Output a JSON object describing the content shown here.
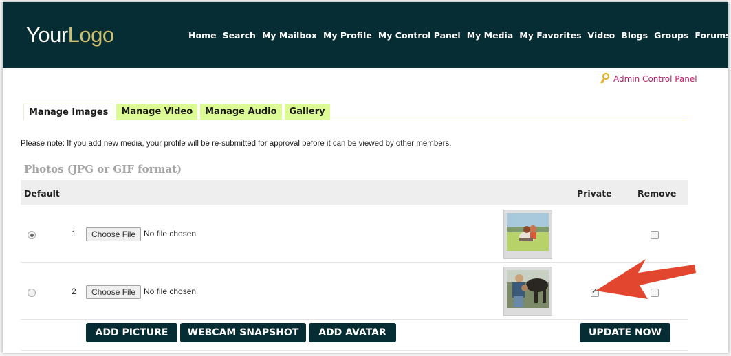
{
  "logo": {
    "your": "Your",
    "logo": "Logo"
  },
  "nav": [
    {
      "label": "Home",
      "name": "nav-home"
    },
    {
      "label": "Search",
      "name": "nav-search"
    },
    {
      "label": "My Mailbox",
      "name": "nav-my-mailbox"
    },
    {
      "label": "My Profile",
      "name": "nav-my-profile"
    },
    {
      "label": "My Control Panel",
      "name": "nav-my-control-panel"
    },
    {
      "label": "My Media",
      "name": "nav-my-media"
    },
    {
      "label": "My Favorites",
      "name": "nav-my-favorites"
    },
    {
      "label": "Video",
      "name": "nav-video"
    },
    {
      "label": "Blogs",
      "name": "nav-blogs"
    },
    {
      "label": "Groups",
      "name": "nav-groups"
    },
    {
      "label": "Forums",
      "name": "nav-forums"
    }
  ],
  "admin": {
    "label": "Admin Control Panel",
    "icon": "key-icon"
  },
  "tabs": [
    {
      "label": "Manage Images",
      "active": true
    },
    {
      "label": "Manage Video",
      "active": false
    },
    {
      "label": "Manage Audio",
      "active": false
    },
    {
      "label": "Gallery",
      "active": false
    }
  ],
  "note": "Please note: If you add new media, your profile will be re-submitted for approval before it can be viewed by other members.",
  "section_title": "Photos (JPG or GIF format)",
  "table": {
    "headers": {
      "default": "Default",
      "private": "Private",
      "remove": "Remove"
    },
    "rows": [
      {
        "num": "1",
        "choose": "Choose File",
        "file": "No file chosen",
        "default": true,
        "private": false,
        "remove": false,
        "thumb": "couple-in-field-photo"
      },
      {
        "num": "2",
        "choose": "Choose File",
        "file": "No file chosen",
        "default": false,
        "private": true,
        "remove": false,
        "thumb": "couple-with-horse-photo"
      }
    ]
  },
  "buttons": {
    "add_picture": "ADD PICTURE",
    "webcam": "WEBCAM SNAPSHOT",
    "add_avatar": "ADD AVATAR",
    "update": "UPDATE NOW"
  },
  "colors": {
    "header_bg": "#062d33",
    "logo_accent": "#cdbf6e",
    "tab_bg": "#ddfb95",
    "admin_link": "#b5226d",
    "arrow": "#e2462f"
  }
}
